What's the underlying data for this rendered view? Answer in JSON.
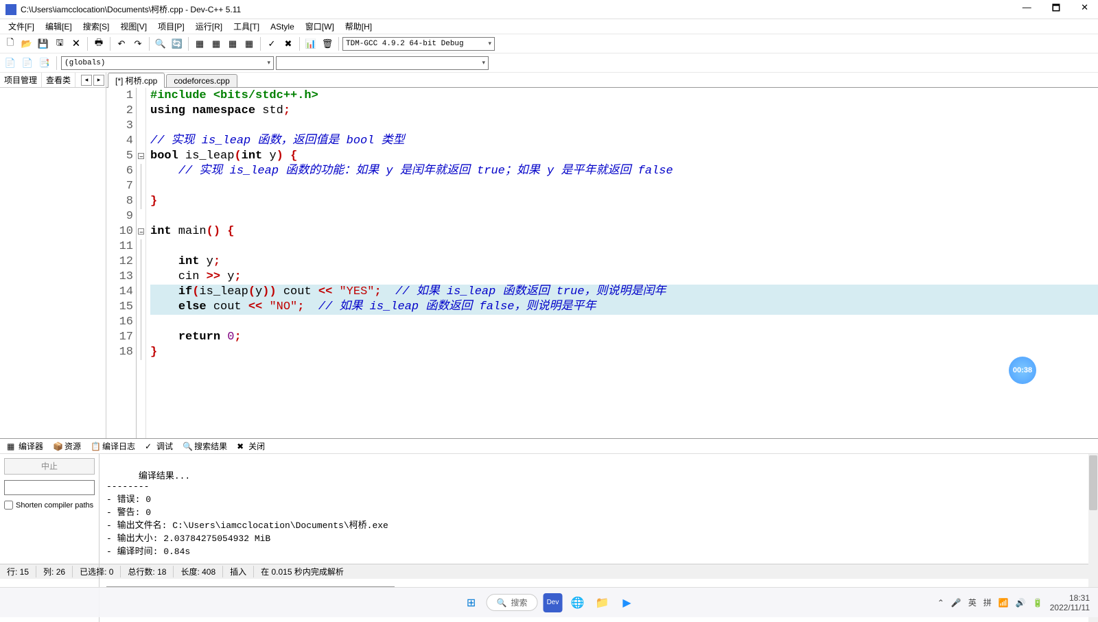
{
  "title": "C:\\Users\\iamcclocation\\Documents\\柯桥.cpp - Dev-C++ 5.11",
  "menu": [
    "文件[F]",
    "编辑[E]",
    "搜索[S]",
    "视图[V]",
    "项目[P]",
    "运行[R]",
    "工具[T]",
    "AStyle",
    "窗口[W]",
    "帮助[H]"
  ],
  "compiler_combo": "TDM-GCC 4.9.2 64-bit Debug",
  "globals_combo": "(globals)",
  "sidebar": {
    "tabs": [
      "项目管理",
      "查看类"
    ]
  },
  "filetabs": [
    {
      "label": "[*] 柯桥.cpp",
      "active": true
    },
    {
      "label": "codeforces.cpp",
      "active": false
    }
  ],
  "code": {
    "lines": [
      {
        "n": 1,
        "html": "<span class='pp'>#include &lt;bits/stdc++.h&gt;</span>"
      },
      {
        "n": 2,
        "html": "<span class='kw'>using</span> <span class='kw'>namespace</span> std<span class='op'>;</span>"
      },
      {
        "n": 3,
        "html": ""
      },
      {
        "n": 4,
        "html": "<span class='cm'>// 实现 is_leap 函数，返回值是 bool 类型</span>"
      },
      {
        "n": 5,
        "fold": true,
        "html": "<span class='kw'>bool</span> is_leap<span class='op'>(</span><span class='kw'>int</span> y<span class='op'>)</span> <span class='op'>{</span>"
      },
      {
        "n": 6,
        "line": true,
        "html": "    <span class='cm'>// 实现 is_leap 函数的功能：如果 y 是闰年就返回 true；如果 y 是平年就返回 false</span>"
      },
      {
        "n": 7,
        "line": true,
        "html": "    "
      },
      {
        "n": 8,
        "line": true,
        "html": "<span class='op'>}</span>"
      },
      {
        "n": 9,
        "html": ""
      },
      {
        "n": 10,
        "fold": true,
        "html": "<span class='kw'>int</span> main<span class='op'>()</span> <span class='op'>{</span>"
      },
      {
        "n": 11,
        "line": true,
        "html": ""
      },
      {
        "n": 12,
        "line": true,
        "html": "    <span class='kw'>int</span> y<span class='op'>;</span>"
      },
      {
        "n": 13,
        "line": true,
        "html": "    cin <span class='op'>&gt;&gt;</span> y<span class='op'>;</span>"
      },
      {
        "n": 14,
        "line": true,
        "hl": true,
        "html": "    <span class='kw'>if</span><span class='op'>(</span>is_leap<span class='op'>(</span>y<span class='op'>))</span> cout <span class='op'>&lt;&lt;</span> <span class='str'>\"YES\"</span><span class='op'>;</span>  <span class='cm'>// 如果 is_leap 函数返回 true，则说明是闰年</span>"
      },
      {
        "n": 15,
        "line": true,
        "hl": true,
        "html": "    <span class='kw'>else</span> cout <span class='op'>&lt;&lt;</span> <span class='str'>\"NO\"</span><span class='op'>;</span>  <span class='cm'>// 如果 is_leap 函数返回 false，则说明是平年</span>"
      },
      {
        "n": 16,
        "line": true,
        "html": ""
      },
      {
        "n": 17,
        "line": true,
        "html": "    <span class='kw'>return</span> <span class='num'>0</span><span class='op'>;</span>"
      },
      {
        "n": 18,
        "line": true,
        "html": "<span class='op'>}</span>"
      }
    ]
  },
  "bottom_tabs": [
    "编译器",
    "资源",
    "编译日志",
    "调试",
    "搜索结果",
    "关闭"
  ],
  "stop_label": "中止",
  "shorten_label": "Shorten compiler paths",
  "compile_output": "编译结果...\n--------\n- 错误: 0\n- 警告: 0\n- 输出文件名: C:\\Users\\iamcclocation\\Documents\\柯桥.exe\n- 输出大小: 2.03784275054932 MiB\n- 编译时间: 0.84s",
  "status": {
    "row": "行:   15",
    "col": "列:   26",
    "sel": "已选择:    0",
    "tot": "总行数:   18",
    "len": "长度:   408",
    "ins": "插入",
    "parse": "在 0.015 秒内完成解析"
  },
  "search_placeholder": "搜索",
  "tray": {
    "ime1": "英",
    "ime2": "拼",
    "time": "18:31",
    "date": "2022/11/11"
  },
  "timer": "00:38"
}
